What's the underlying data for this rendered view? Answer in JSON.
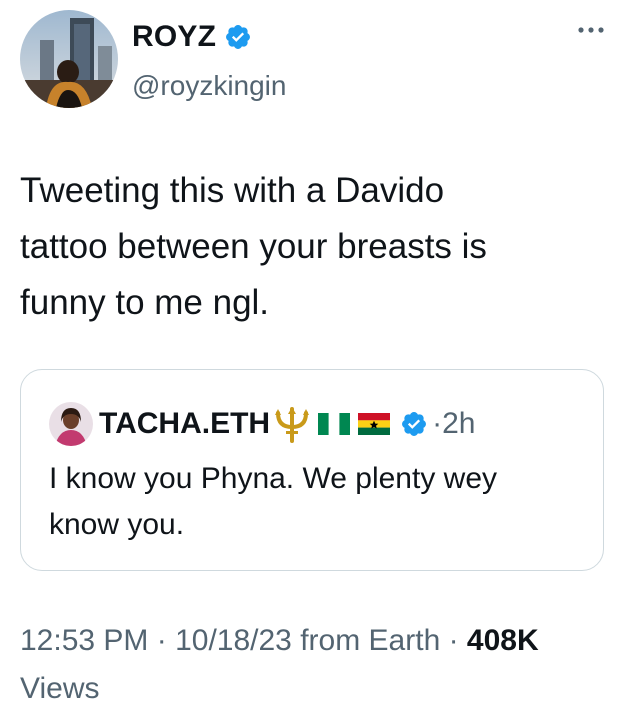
{
  "tweet": {
    "author": {
      "display_name": "ROYZ",
      "handle": "@royzkingin",
      "verified": true,
      "avatar": "user-avatar"
    },
    "text": "Tweeting this with a Davido\ntattoo between your breasts is\nfunny to me ngl.",
    "more_icon": "more-horizontal-icon"
  },
  "quoted": {
    "author": {
      "display_name": "TACHA.ETH",
      "emojis": [
        "trident-emoji",
        "nigeria-flag",
        "ghana-flag"
      ],
      "verified": true,
      "avatar": "quoted-user-avatar"
    },
    "separator": "·",
    "time": "2h",
    "text": "I know you Phyna. We plenty wey\nknow you."
  },
  "meta": {
    "time": "12:53 PM",
    "sep1": " · ",
    "date": "10/18/23",
    "source": " from Earth",
    "sep2": " · ",
    "views_count": "408K",
    "views_label": "Views"
  },
  "colors": {
    "text": "#0f1419",
    "secondary": "#536471",
    "verified_blue": "#1d9bf0",
    "border": "#cfd9de"
  }
}
